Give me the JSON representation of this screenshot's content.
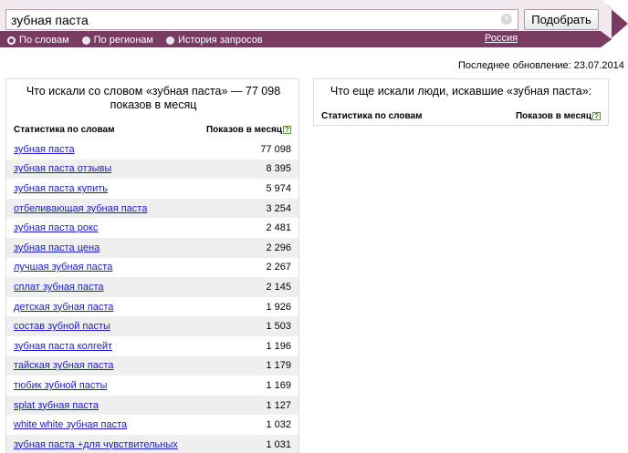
{
  "search": {
    "query": "зубная паста",
    "submit_label": "Подобрать",
    "modes": [
      {
        "label": "По словам",
        "selected": true
      },
      {
        "label": "По регионам",
        "selected": false
      },
      {
        "label": "История запросов",
        "selected": false
      }
    ],
    "region": "Россия"
  },
  "updated": "Последнее обновление: 23.07.2014",
  "left_panel": {
    "title": "Что искали со словом «зубная паста» — 77 098 показов в месяц",
    "col_keyword": "Статистика по словам",
    "col_count": "Показов в месяц",
    "rows": [
      {
        "phrase": "зубная паста",
        "count": "77 098"
      },
      {
        "phrase": "зубная паста отзывы",
        "count": "8 395"
      },
      {
        "phrase": "зубная паста купить",
        "count": "5 974"
      },
      {
        "phrase": "отбеливающая зубная паста",
        "count": "3 254"
      },
      {
        "phrase": "зубная паста рокс",
        "count": "2 481"
      },
      {
        "phrase": "зубная паста цена",
        "count": "2 296"
      },
      {
        "phrase": "лучшая зубная паста",
        "count": "2 267"
      },
      {
        "phrase": "сплат зубная паста",
        "count": "2 145"
      },
      {
        "phrase": "детская зубная паста",
        "count": "1 926"
      },
      {
        "phrase": "состав зубной пасты",
        "count": "1 503"
      },
      {
        "phrase": "зубная паста колгейт",
        "count": "1 196"
      },
      {
        "phrase": "тайская зубная паста",
        "count": "1 179"
      },
      {
        "phrase": "тюбик зубной пасты",
        "count": "1 169"
      },
      {
        "phrase": "splat зубная паста",
        "count": "1 127"
      },
      {
        "phrase": "white white зубная паста",
        "count": "1 032"
      },
      {
        "phrase": "зубная паста +для чувствительных",
        "count": "1 031"
      }
    ]
  },
  "right_panel": {
    "title": "Что еще искали люди, искавшие «зубная паста»:",
    "col_keyword": "Статистика по словам",
    "col_count": "Показов в месяц"
  },
  "colors": {
    "header_bar": "#7a3b63",
    "link": "#1a1acc",
    "row_alt": "#efefef"
  }
}
